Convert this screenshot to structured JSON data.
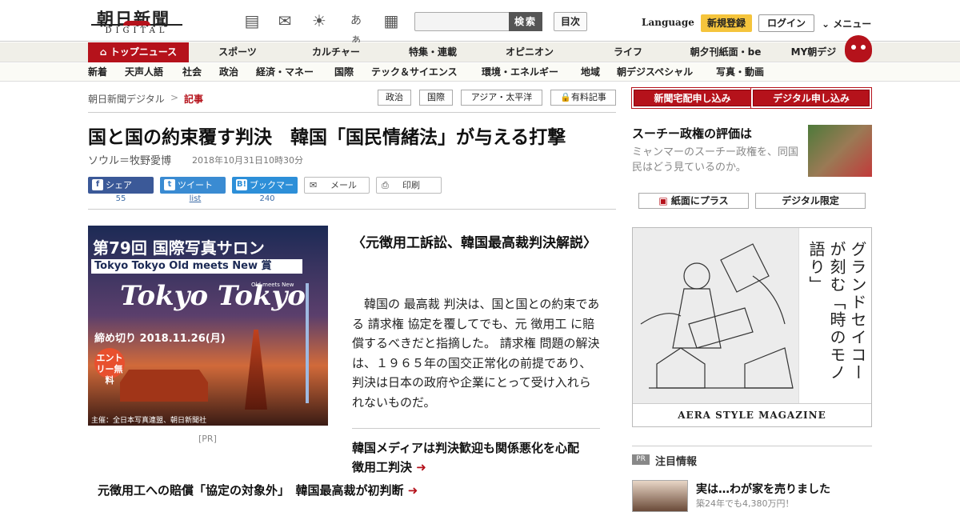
{
  "header": {
    "logo_top": "朝日新聞",
    "logo_bottom": "DIGITAL",
    "search_button": "検索",
    "mokuji": "目次",
    "language": "Language",
    "register": "新規登録",
    "login": "ログイン",
    "menu": "メニュー",
    "font_size_glyph": "あぁ"
  },
  "nav1": {
    "top": "トップニュース",
    "items": [
      "スポーツ",
      "カルチャー",
      "特集・連載",
      "オピニオン",
      "ライフ",
      "朝夕刊紙面・be",
      "MY朝デジ"
    ]
  },
  "nav2": {
    "items": [
      "新着",
      "天声人語",
      "社会",
      "政治",
      "経済・マネー",
      "国際",
      "テック＆サイエンス",
      "環境・エネルギー",
      "地域",
      "朝デジスペシャル",
      "写真・動画"
    ]
  },
  "breadcrumb": {
    "home": "朝日新聞デジタル",
    "sep": ">",
    "current": "記事"
  },
  "tags": [
    "政治",
    "国際",
    "アジア・太平洋",
    "有料記事"
  ],
  "subscribe": {
    "paper": "新聞宅配申し込み",
    "digital": "デジタル申し込み"
  },
  "article": {
    "title": "国と国の約束覆す判決　韓国「国民情緒法」が与える打撃",
    "byline": "ソウル＝牧野愛博",
    "date": "2018年10月31日10時30分",
    "subhead": "〈元徴用工訴訟、韓国最高裁判決解説〉",
    "body": "　韓国の 最高裁 判決は、国と国との約束である 請求権 協定を覆してでも、元 徴用工 に賠償するべきだと指摘した。 請求権 問題の解決は、１９６５年の国交正常化の前提であり、判決は日本の政府や企業にとって受け入れられないものだ。",
    "related1": "韓国メディアは判決歓迎も関係悪化を心配　徴用工判決",
    "related2": "元徴用工への賠償「協定の対象外」　韓国最高裁が初判断"
  },
  "share": {
    "facebook": "シェア",
    "facebook_count": "55",
    "twitter": "ツイート",
    "twitter_count": "list",
    "hatena": "ブックマーク",
    "hatena_count": "240",
    "mail": "メール",
    "print": "印刷"
  },
  "ad_left": {
    "title": "第79回 国際写真サロン",
    "subtitle": "Tokyo Tokyo Old meets New 賞",
    "logo": "Tokyo Tokyo",
    "logo_small": "Old meets New",
    "deadline": "締め切り 2018.11.26(月)",
    "entry": "エントリー無料",
    "sponsor": "主催：全日本写真連盟、朝日新聞社",
    "pr": "[PR]"
  },
  "right": {
    "feature_title": "スーチー政権の評価は",
    "feature_desc": "ミャンマーのスーチー政権を、同国民はどう見ているのか。",
    "paper_plus": "紙面にプラス",
    "digital_only": "デジタル限定",
    "ad_vertical": "グランドセイコーが刻む「時のモノ語り」",
    "ad_footer": "AERA STYLE MAGAZINE",
    "pr_label": "PR",
    "attention": "注目情報",
    "promo_title": "実は…わが家を売りました",
    "promo_sub": "築24年でも4,380万円！"
  }
}
